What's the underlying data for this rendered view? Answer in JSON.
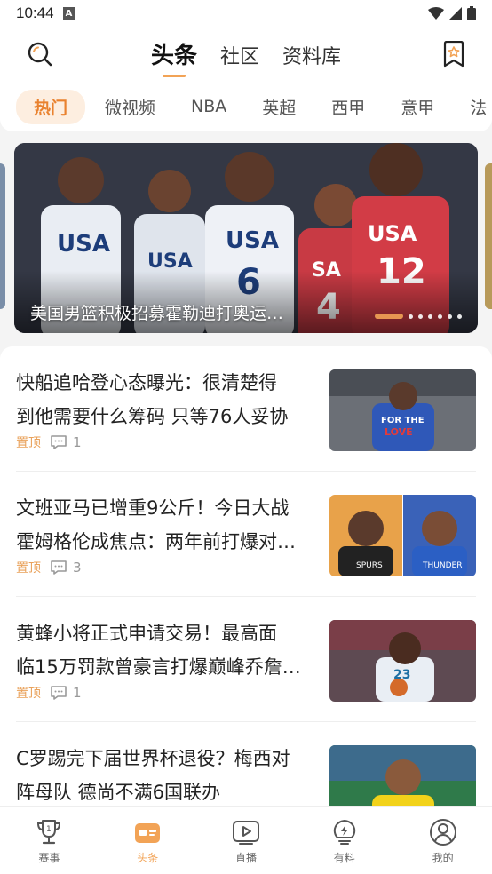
{
  "status_bar": {
    "time": "10:44",
    "a_icon": "A"
  },
  "top_nav": {
    "tabs": [
      {
        "label": "头条",
        "active": true
      },
      {
        "label": "社区",
        "active": false
      },
      {
        "label": "资料库",
        "active": false
      }
    ]
  },
  "categories": [
    "热门",
    "微视频",
    "NBA",
    "英超",
    "西甲",
    "意甲",
    "法"
  ],
  "banner": {
    "caption": "美国男篮积极招募霍勒迪打奥运…",
    "dot_count": 7,
    "active_dot": 0
  },
  "news": [
    {
      "line1": "快船追哈登心态曝光：很清楚得",
      "line2": "到他需要什么筹码 只等76人妥协",
      "pin": "置顶",
      "comments": "1"
    },
    {
      "line1": "文班亚马已增重9公斤！今日大战",
      "line2": "霍姆格伦成焦点：两年前打爆对…",
      "pin": "置顶",
      "comments": "3"
    },
    {
      "line1": "黄蜂小将正式申请交易！最高面",
      "line2": "临15万罚款曾豪言打爆巅峰乔詹…",
      "pin": "置顶",
      "comments": "1"
    },
    {
      "line1": "C罗踢完下届世界杯退役？梅西对",
      "line2": "阵母队 德尚不满6国联办",
      "pin": "",
      "comments": ""
    }
  ],
  "tab_bar": [
    {
      "label": "赛事",
      "icon": "trophy-icon",
      "active": false
    },
    {
      "label": "头条",
      "icon": "news-icon",
      "active": true
    },
    {
      "label": "直播",
      "icon": "play-icon",
      "active": false
    },
    {
      "label": "有料",
      "icon": "bolt-icon",
      "active": false
    },
    {
      "label": "我的",
      "icon": "profile-icon",
      "active": false
    }
  ],
  "colors": {
    "accent": "#f2a356",
    "accent_text": "#e9822f",
    "pin": "#e9a15a"
  }
}
